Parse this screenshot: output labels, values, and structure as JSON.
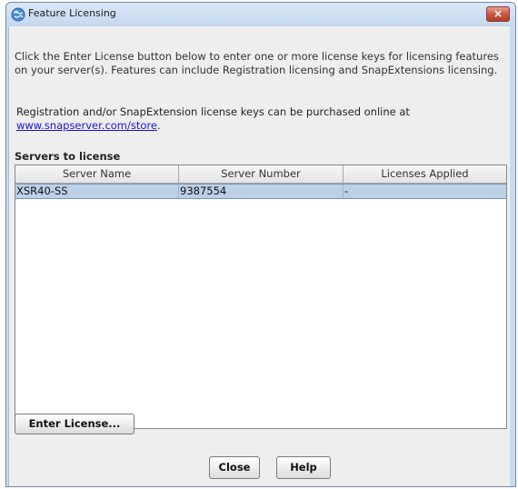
{
  "window": {
    "title": "Feature Licensing",
    "close_glyph": "×"
  },
  "intro_text": "Click the Enter License button below to enter one or more license keys for licensing features on your server(s). Features can include Registration licensing and SnapExtensions licensing.",
  "purchase": {
    "text": "Registration and/or SnapExtension license keys can be purchased online at",
    "link": "www.snapserver.com/store",
    "link_suffix": "."
  },
  "servers": {
    "label": "Servers to license",
    "columns": [
      "Server Name",
      "Server Number",
      "Licenses Applied"
    ],
    "rows": [
      {
        "name": "XSR40-SS",
        "number": "9387554",
        "licenses": "-"
      }
    ]
  },
  "buttons": {
    "enter_license": "Enter License...",
    "close": "Close",
    "help": "Help"
  },
  "icons": {
    "app": "globe-icon",
    "close": "close-icon"
  },
  "colors": {
    "selected_row": "#bcd0e6",
    "link": "#1a12d8",
    "close_button": "#c75844"
  }
}
